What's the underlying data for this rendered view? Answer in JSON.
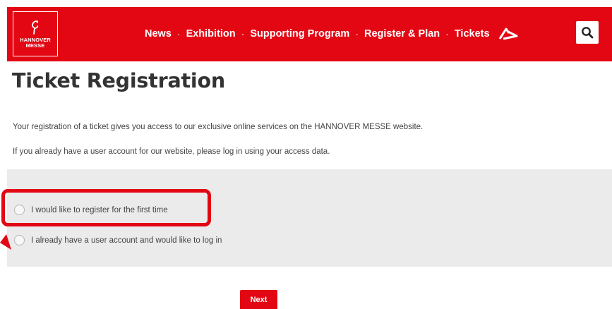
{
  "header": {
    "logo": {
      "line1": "HANNOVER",
      "line2": "MESSE",
      "icon": "hannover-horse-icon"
    },
    "nav": [
      {
        "label": "News"
      },
      {
        "label": "Exhibition"
      },
      {
        "label": "Supporting Program"
      },
      {
        "label": "Register & Plan"
      },
      {
        "label": "Tickets"
      }
    ],
    "separator": "·",
    "extra_icon": "arrow-logo-icon",
    "search_icon": "search-icon"
  },
  "main": {
    "title": "Ticket Registration",
    "intro_1": "Your registration of a ticket gives you access to our exclusive online services on the HANNOVER MESSE website.",
    "intro_2": "If you already have a user account for our website, please log in using your access data.",
    "options": [
      {
        "label": "I would like to register for the first time",
        "selected": false
      },
      {
        "label": "I already have a user account and would like to log in",
        "selected": false
      }
    ],
    "next_label": "Next"
  },
  "colors": {
    "brand_red": "#e30613",
    "panel_gray": "#ebebeb",
    "text": "#333333"
  }
}
